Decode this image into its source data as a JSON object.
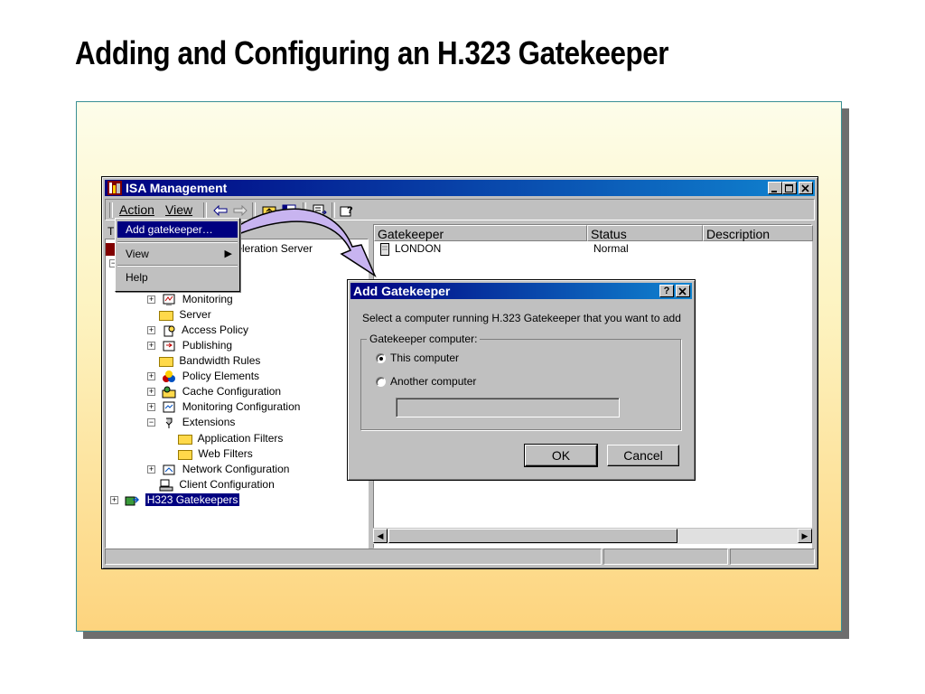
{
  "slide": {
    "title": "Adding and Configuring an H.323 Gatekeeper"
  },
  "window": {
    "title": "ISA Management",
    "menu": {
      "action": "Action",
      "view": "View"
    },
    "left_tab_fragment": "T",
    "tree": [
      {
        "label": "celeration Server",
        "icon": "server-icon"
      },
      {
        "label": "Monitoring",
        "icon": "monitoring-icon"
      },
      {
        "label": "Server",
        "icon": "server-folder-icon"
      },
      {
        "label": "Access Policy",
        "icon": "access-policy-icon"
      },
      {
        "label": "Publishing",
        "icon": "publishing-icon"
      },
      {
        "label": "Bandwidth Rules",
        "icon": "folder-icon"
      },
      {
        "label": "Policy Elements",
        "icon": "policy-elements-icon"
      },
      {
        "label": "Cache Configuration",
        "icon": "cache-icon"
      },
      {
        "label": "Monitoring Configuration",
        "icon": "monitoring-config-icon"
      },
      {
        "label": "Extensions",
        "icon": "extensions-icon"
      },
      {
        "label": "Application Filters",
        "icon": "folder-icon"
      },
      {
        "label": "Web Filters",
        "icon": "folder-icon"
      },
      {
        "label": "Network Configuration",
        "icon": "network-icon"
      },
      {
        "label": "Client Configuration",
        "icon": "client-config-icon"
      },
      {
        "label": "H323 Gatekeepers",
        "icon": "gatekeeper-icon"
      }
    ],
    "columns": [
      "Gatekeeper",
      "Status",
      "Description"
    ],
    "rows": [
      {
        "gatekeeper": "LONDON",
        "status": "Normal",
        "description": ""
      }
    ]
  },
  "action_menu": {
    "items": [
      {
        "label": "Add gatekeeper…",
        "highlighted": true
      },
      {
        "label": "View",
        "submenu": true
      },
      {
        "label": "Help"
      }
    ]
  },
  "dialog": {
    "title": "Add Gatekeeper",
    "help_button": "?",
    "prompt": "Select a computer running H.323 Gatekeeper that you want to add",
    "group_label": "Gatekeeper computer:",
    "options": [
      {
        "label": "This computer",
        "selected": true
      },
      {
        "label": "Another computer",
        "selected": false
      }
    ],
    "computer_name_value": "",
    "ok_label": "OK",
    "cancel_label": "Cancel"
  },
  "colors": {
    "titlebar_start": "#000080",
    "titlebar_end": "#1084d0",
    "face": "#c0c0c0",
    "arrow_fill": "#c8b4f0"
  }
}
